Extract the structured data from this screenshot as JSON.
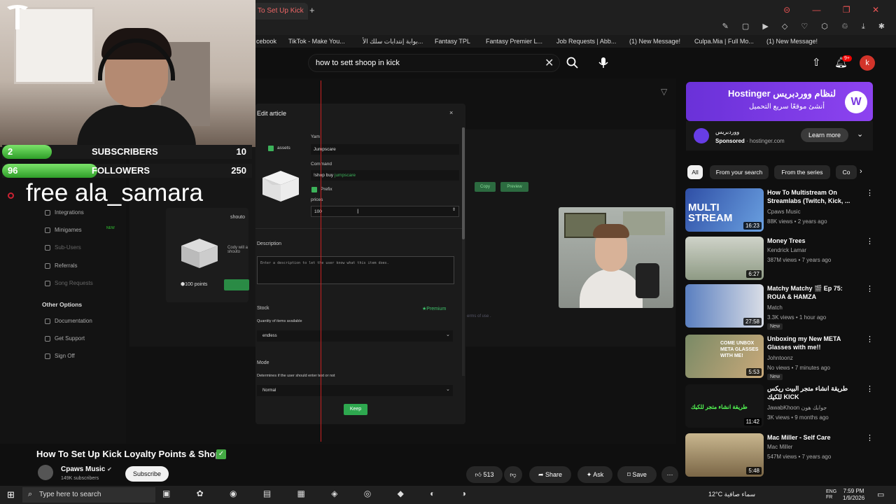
{
  "browser": {
    "active_tab": "To Set Up Kick",
    "bookmarks": [
      "cebook",
      "TikTok - Make You...",
      "بوابة إنتدابات سلك الأ...",
      "Fantasy TPL",
      "Fantasy Premier L...",
      "Job Requests | Abb...",
      "(1) New Message!",
      "Culpa.Mia | Full Mo...",
      "(1) New Message!"
    ]
  },
  "youtube_header": {
    "search_value": "how to sett shoop in kick",
    "notifications": "9+",
    "avatar_letter": "k"
  },
  "stream_overlay": {
    "subs_left": "2",
    "subs_label": "SUBSCRIBERS",
    "subs_right": "10",
    "subs_progress": 0.2,
    "followers_left": "96",
    "followers_label": "FOLLOWERS",
    "followers_right": "250",
    "followers_progress": 0.38,
    "free_text": "free ala_samara"
  },
  "kick_dashboard": {
    "sidebar": [
      "Integrations",
      "Minigames",
      "Sub-Users",
      "Referrals",
      "Song Requests"
    ],
    "other_header": "Other Options",
    "other_items": [
      "Documentation",
      "Get Support",
      "Sign Off"
    ],
    "copy_label": "Copy",
    "preview_label": "Preview",
    "points_label": "100 points",
    "card_title": "shouto",
    "card_text": "Cody will a shouto"
  },
  "modal": {
    "title": "Edit article",
    "close": "×",
    "assets_label": "assets",
    "name_label": "Yam",
    "name_value": "Jumpscare",
    "command_label": "Command",
    "command_value": "!shop buy ",
    "command_highlight": "jumpscare",
    "prefix_label": "Prefix",
    "prices_label": "prices",
    "prices_value": "100",
    "description_label": "Description",
    "description_placeholder": "Enter a description to let the user know what this item does.",
    "stock_label": "Stock",
    "premium_label": "Premium",
    "quantity_label": "Quantity of items available",
    "stock_value": "endless",
    "mode_label": "Mode",
    "mode_desc": "Determines if the user should enter text or not",
    "mode_value": "Normal",
    "keep_label": "Keep"
  },
  "video": {
    "title": "How To Set Up Kick Loyalty Points & Shop",
    "channel": "Cpaws Music",
    "subscribers": "149K subscribers",
    "subscribe_label": "Subscribe",
    "likes": "513",
    "share_label": "Share",
    "ask_label": "Ask",
    "save_label": "Save",
    "terms_text": "erms of use ."
  },
  "ad": {
    "title": "Hostinger لنظام ووردبريس",
    "subtitle": "أنشئ موقعًا سريع التحميل",
    "name": "ووردبريس",
    "sponsored": "Sponsored",
    "domain": "hostinger.com",
    "learn_more": "Learn more"
  },
  "chips": [
    "All",
    "From your search",
    "From the series",
    "Co"
  ],
  "recommendations": [
    {
      "title": "How To Multistream On Streamlabs (Twitch, Kick, ...",
      "channel": "Cpaws Music",
      "meta": "88K views • 2 years ago",
      "duration": "16:23",
      "thumb_text": "MULTI STREAM",
      "badge": ""
    },
    {
      "title": "Money Trees",
      "channel": "Kendrick Lamar",
      "meta": "387M views • 7 years ago",
      "duration": "6:27",
      "thumb_text": "",
      "badge": ""
    },
    {
      "title": "Matchy Matchy 🎬 Ep 75: ROUA & HAMZA",
      "channel": "Match",
      "meta": "3.3K views • 1 hour ago",
      "duration": "27:58",
      "thumb_text": "",
      "badge": "New"
    },
    {
      "title": "Unboxing my New META Glasses with me!!",
      "channel": "Johntoonz",
      "meta": "No views • 7 minutes ago",
      "duration": "5:53",
      "thumb_text": "COME UNBOX META GLASSES WITH ME!",
      "badge": "New"
    },
    {
      "title": "طريقة انشاء متجر البيت ريكس للكيك KICK",
      "channel": "JawabKhoon جوابك هون",
      "meta": "3K views • 9 months ago",
      "duration": "11:42",
      "thumb_text": "طريقة انشاء متجر للكيك",
      "badge": ""
    },
    {
      "title": "Mac Miller - Self Care",
      "channel": "Mac Miller",
      "meta": "547M views • 7 years ago",
      "duration": "5:48",
      "thumb_text": "",
      "badge": ""
    }
  ],
  "taskbar": {
    "search_placeholder": "Type here to search",
    "weather": "12°C سماء صافية",
    "lang": "ENG FR",
    "time": "7:59 PM",
    "date": "1/9/2026"
  }
}
